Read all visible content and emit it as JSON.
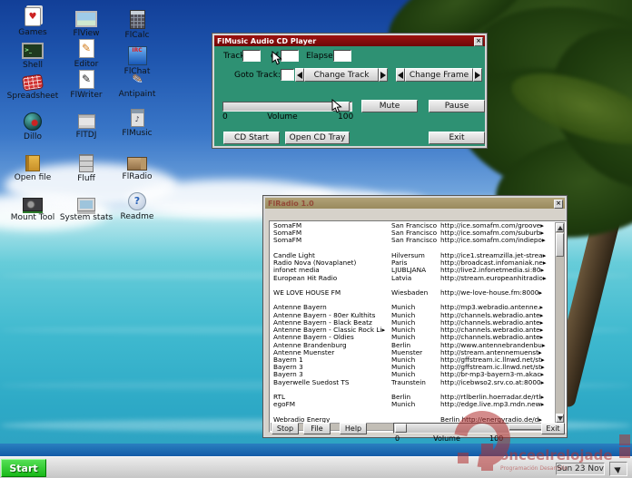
{
  "desktop": {
    "icons": [
      {
        "label": "Games",
        "icon": "playing-cards-icon",
        "glyph": "♥"
      },
      {
        "label": "FlView",
        "icon": "image-viewer-icon",
        "glyph": ""
      },
      {
        "label": "FlCalc",
        "icon": "calculator-icon",
        "glyph": ""
      },
      {
        "label": "Shell",
        "icon": "terminal-icon",
        "glyph": ">_"
      },
      {
        "label": "Editor",
        "icon": "editor-icon",
        "glyph": "✎"
      },
      {
        "label": "FlChat",
        "icon": "irc-chat-icon",
        "glyph": "IRC"
      },
      {
        "label": "Spreadsheet",
        "icon": "spreadsheet-icon",
        "glyph": ""
      },
      {
        "label": "FlWriter",
        "icon": "writer-icon",
        "glyph": "✎"
      },
      {
        "label": "Antipaint",
        "icon": "paintbrush-icon",
        "glyph": "✏"
      },
      {
        "label": "Dillo",
        "icon": "globe-icon",
        "glyph": ""
      },
      {
        "label": "FlTDJ",
        "icon": "floppy-icon",
        "glyph": ""
      },
      {
        "label": "FlMusic",
        "icon": "music-player-icon",
        "glyph": "♪"
      },
      {
        "label": "Open file",
        "icon": "open-file-icon",
        "glyph": ""
      },
      {
        "label": "Fluff",
        "icon": "file-cabinet-icon",
        "glyph": ""
      },
      {
        "label": "FlRadio",
        "icon": "radio-icon",
        "glyph": ""
      },
      {
        "label": "Mount Tool",
        "icon": "disk-icon",
        "glyph": ""
      },
      {
        "label": "System stats",
        "icon": "monitor-icon",
        "glyph": ""
      },
      {
        "label": "Readme",
        "icon": "readme-help-icon",
        "glyph": "?"
      }
    ]
  },
  "cd_player": {
    "title": "FlMusic Audio CD Player",
    "close_glyph": "×",
    "track_label": "Track",
    "of_label": "of",
    "elapsed_label": "Elapsed:",
    "goto_label": "Goto Track:",
    "track_value": "",
    "of_value": "",
    "elapsed_value": "",
    "goto_value": "",
    "change_track_label": "Change Track",
    "change_frame_label": "Change Frame",
    "mute_label": "Mute",
    "pause_label": "Pause",
    "cd_start_label": "CD Start",
    "open_tray_label": "Open CD Tray",
    "exit_label": "Exit",
    "volume": {
      "min": "0",
      "label": "Volume",
      "max": "100"
    }
  },
  "radio": {
    "title": "FlRadio 1.0",
    "close_glyph": "×",
    "stop_label": "Stop",
    "file_label": "File",
    "help_label": "Help",
    "exit_label": "Exit",
    "volume": {
      "min": "0",
      "label": "Volume",
      "max": "100"
    },
    "stations": [
      {
        "name": "SomaFM",
        "city": "San Francisco",
        "url": "http://ice.somafm.com/groove▸"
      },
      {
        "name": "SomaFM",
        "city": "San Francisco",
        "url": "http://ice.somafm.com/suburb▸"
      },
      {
        "name": "SomaFM",
        "city": "San Francisco",
        "url": "http://ice.somafm.com/indiepo▸"
      },
      {
        "name": "",
        "city": "",
        "url": ""
      },
      {
        "name": "Candle Light",
        "city": "Hilversum",
        "url": "http://ice1.streamzilla.jet-strea▸"
      },
      {
        "name": "Radio Nova (Novaplanet)",
        "city": "Paris",
        "url": "http://broadcast.infomaniak.ne▸"
      },
      {
        "name": "infonet media",
        "city": "LJUBLJANA",
        "url": "http://live2.infonetmedia.si:80▸"
      },
      {
        "name": "European Hit Radio",
        "city": "Latvia",
        "url": "http://stream.europeanhitradio▸"
      },
      {
        "name": "",
        "city": "",
        "url": ""
      },
      {
        "name": "WE LOVE HOUSE FM",
        "city": "Wiesbaden",
        "url": "http://we-love-house.fm:8000▸"
      },
      {
        "name": "",
        "city": "",
        "url": ""
      },
      {
        "name": "Antenne Bayern",
        "city": "Munich",
        "url": "http://mp3.webradio.antenne.▸"
      },
      {
        "name": "Antenne Bayern - 80er Kulthits",
        "city": "Munich",
        "url": "http://channels.webradio.ante▸"
      },
      {
        "name": "Antenne Bayern - Black Beatz",
        "city": "Munich",
        "url": "http://channels.webradio.ante▸"
      },
      {
        "name": "Antenne Bayern - Classic Rock Li▸",
        "city": "Munich",
        "url": "http://channels.webradio.ante▸"
      },
      {
        "name": "Antenne Bayern - Oldies",
        "city": "Munich",
        "url": "http://channels.webradio.ante▸"
      },
      {
        "name": "Antenne Brandenburg",
        "city": "Berlin",
        "url": "http://www.antennebrandenbu▸"
      },
      {
        "name": "Antenne Muenster",
        "city": "Muenster",
        "url": "http://stream.antennemuenst▸"
      },
      {
        "name": "Bayern 1",
        "city": "Munich",
        "url": "http://gffstream.ic.llnwd.net/st▸"
      },
      {
        "name": "Bayern 3",
        "city": "Munich",
        "url": "http://gffstream.ic.llnwd.net/st▸"
      },
      {
        "name": "Bayern 3",
        "city": "Munich",
        "url": "http://br-mp3-bayern3-m.akac▸"
      },
      {
        "name": "Bayerwelle Suedost TS",
        "city": "Traunstein",
        "url": "http://icebwso2.srv.co.at:8000▸"
      },
      {
        "name": "",
        "city": "",
        "url": ""
      },
      {
        "name": "RTL",
        "city": "Berlin",
        "url": "http://rtlberlin.hoerradar.de/rtl▸"
      },
      {
        "name": "egoFM",
        "city": "Munich",
        "url": "http://edge.live.mp3.mdn.new▸"
      },
      {
        "name": "",
        "city": "",
        "url": ""
      },
      {
        "name": "Webradio Energy",
        "city": "",
        "url": "Berlin  http://energyradio.de/d▸"
      }
    ]
  },
  "taskbar": {
    "start_label": "Start",
    "clock": "Sun 23 Nov"
  },
  "watermark": {
    "text": "onceelrelojade",
    "tagline": "Programación Desarrollo"
  },
  "colors": {
    "cd_window_bg": "#2e9173",
    "cd_titlebar": "#8f1010",
    "radio_titlebar": "#a89a72",
    "start_button": "#22c522",
    "taskbar_bg": "#d4d4d4",
    "sky_top": "#123f98",
    "ocean": "#3fb9cf"
  }
}
